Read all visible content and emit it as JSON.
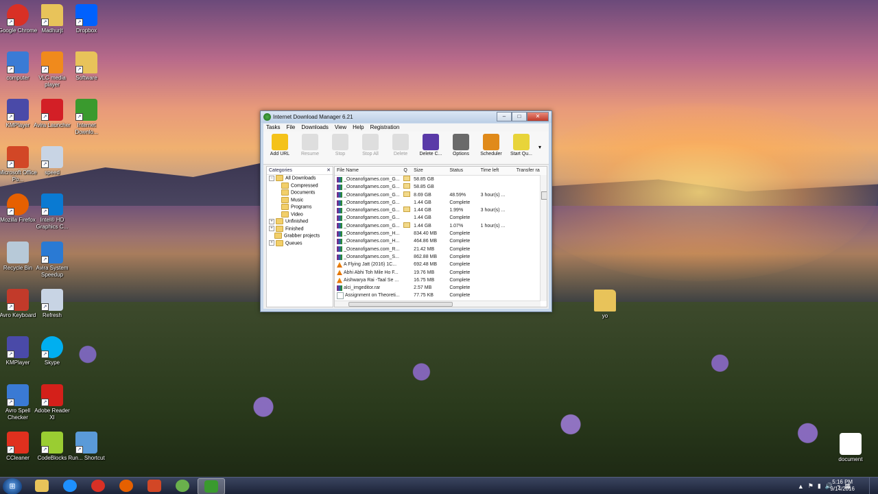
{
  "desktop_icons": [
    {
      "label": "Google Chrome",
      "icon": "chrome-icon",
      "color": "#d93025"
    },
    {
      "label": "Madhurjt",
      "icon": "folder-user-icon",
      "color": "#e8c35a"
    },
    {
      "label": "Dropbox",
      "icon": "dropbox-icon",
      "color": "#0061fe"
    },
    {
      "label": "computer",
      "icon": "computer-icon",
      "color": "#3a7bd5"
    },
    {
      "label": "VLC media player",
      "icon": "vlc-icon",
      "color": "#f08a1c"
    },
    {
      "label": "Software",
      "icon": "folder-icon",
      "color": "#e8c35a"
    },
    {
      "label": "KMPlayer",
      "icon": "kmplayer-icon",
      "color": "#4a4aa8"
    },
    {
      "label": "Avira Launcher",
      "icon": "avira-icon",
      "color": "#d31f26"
    },
    {
      "label": "Internet Downlo...",
      "icon": "idm-icon",
      "color": "#3a9a2e"
    },
    {
      "label": "Microsoft Office Po...",
      "icon": "powerpoint-icon",
      "color": "#d24726"
    },
    {
      "label": "speed",
      "icon": "gear-icon",
      "color": "#c8d4e4"
    },
    {
      "label": "Mozilla Firefox",
      "icon": "firefox-icon",
      "color": "#e66000"
    },
    {
      "label": "Intel® HD Graphics C...",
      "icon": "intel-icon",
      "color": "#0a7ad2"
    },
    {
      "label": "Recycle Bin",
      "icon": "recycle-bin-icon",
      "color": "#b7c9d8"
    },
    {
      "label": "Avira System Speedup",
      "icon": "speedup-icon",
      "color": "#2a7ad4"
    },
    {
      "label": "Avro Keyboard",
      "icon": "avro-icon",
      "color": "#c23a2a"
    },
    {
      "label": "Refresh",
      "icon": "gear-icon",
      "color": "#c8d4e4"
    },
    {
      "label": "KMPlayer",
      "icon": "kmplayer-icon",
      "color": "#4a4aa8"
    },
    {
      "label": "Skype",
      "icon": "skype-icon",
      "color": "#00aff0"
    },
    {
      "label": "Avro Spell Checker",
      "icon": "spellcheck-icon",
      "color": "#3a7ad4"
    },
    {
      "label": "Adobe Reader XI",
      "icon": "adobe-reader-icon",
      "color": "#d4201a"
    },
    {
      "label": "CCleaner",
      "icon": "ccleaner-icon",
      "color": "#e0301e"
    },
    {
      "label": "CodeBlocks",
      "icon": "codeblocks-icon",
      "color": "#9acd32"
    },
    {
      "label": "Run... Shortcut",
      "icon": "run-icon",
      "color": "#5a9ad8"
    },
    {
      "label": "yo",
      "icon": "folder-user-icon",
      "color": "#e8c35a"
    },
    {
      "label": "document",
      "icon": "document-icon",
      "color": "#ffffff"
    }
  ],
  "idm": {
    "title": "Internet Download Manager 6.21",
    "window_buttons": [
      "–",
      "□",
      "✕"
    ],
    "menu": [
      "Tasks",
      "File",
      "Downloads",
      "View",
      "Help",
      "Registration"
    ],
    "toolbar": [
      {
        "label": "Add URL",
        "icon": "add-url-icon",
        "color": "#f4c21a",
        "enabled": true
      },
      {
        "label": "Resume",
        "icon": "resume-icon",
        "color": "#c0c0c0",
        "enabled": false
      },
      {
        "label": "Stop",
        "icon": "stop-icon",
        "color": "#c0c0c0",
        "enabled": false
      },
      {
        "label": "Stop All",
        "icon": "stop-all-icon",
        "color": "#c0c0c0",
        "enabled": false
      },
      {
        "label": "Delete",
        "icon": "delete-icon",
        "color": "#c0c0c0",
        "enabled": false
      },
      {
        "label": "Delete C...",
        "icon": "delete-completed-icon",
        "color": "#5a3aa8",
        "enabled": true
      },
      {
        "label": "Options",
        "icon": "options-icon",
        "color": "#6a6a6a",
        "enabled": true
      },
      {
        "label": "Scheduler",
        "icon": "scheduler-icon",
        "color": "#e08a1a",
        "enabled": true
      },
      {
        "label": "Start Qu...",
        "icon": "start-queue-icon",
        "color": "#e8d43a",
        "enabled": true
      }
    ],
    "toolbar_more": "▾",
    "categories_title": "Categories",
    "categories": [
      {
        "label": "All Downloads",
        "level": 0,
        "expander": "−"
      },
      {
        "label": "Compressed",
        "level": 1
      },
      {
        "label": "Documents",
        "level": 1
      },
      {
        "label": "Music",
        "level": 1
      },
      {
        "label": "Programs",
        "level": 1
      },
      {
        "label": "Video",
        "level": 1
      },
      {
        "label": "Unfinished",
        "level": 0,
        "expander": "+"
      },
      {
        "label": "Finished",
        "level": 0,
        "expander": "+"
      },
      {
        "label": "Grabber projects",
        "level": 0
      },
      {
        "label": "Queues",
        "level": 0,
        "expander": "+"
      }
    ],
    "columns": [
      "File Name",
      "Q",
      "Size",
      "Status",
      "Time left",
      "Transfer ra"
    ],
    "files": [
      {
        "name": "_Oceanofgames.com_G...",
        "type": "rar",
        "q": true,
        "size": "58.85 GB",
        "status": "",
        "time": ""
      },
      {
        "name": "_Oceanofgames.com_G...",
        "type": "rar",
        "q": true,
        "size": "58.85 GB",
        "status": "",
        "time": ""
      },
      {
        "name": "_Oceanofgames.com_G...",
        "type": "rar",
        "q": true,
        "size": "8.69 GB",
        "status": "48.59%",
        "time": "3 hour(s) ..."
      },
      {
        "name": "_Oceanofgames.com_G...",
        "type": "rar",
        "q": false,
        "size": "1.44 GB",
        "status": "Complete",
        "time": ""
      },
      {
        "name": "_Oceanofgames.com_G...",
        "type": "rar",
        "q": true,
        "size": "1.44 GB",
        "status": "1.99%",
        "time": "3 hour(s) ..."
      },
      {
        "name": "_Oceanofgames.com_G...",
        "type": "rar",
        "q": false,
        "size": "1.44 GB",
        "status": "Complete",
        "time": ""
      },
      {
        "name": "_Oceanofgames.com_G...",
        "type": "rar",
        "q": true,
        "size": "1.44 GB",
        "status": "1.07%",
        "time": "1 hour(s) ..."
      },
      {
        "name": "_Oceanofgames.com_H...",
        "type": "rar",
        "q": false,
        "size": "834.40 MB",
        "status": "Complete",
        "time": ""
      },
      {
        "name": "_Oceanofgames.com_H...",
        "type": "rar",
        "q": false,
        "size": "464.86 MB",
        "status": "Complete",
        "time": ""
      },
      {
        "name": "_Oceanofgames.com_R...",
        "type": "rar",
        "q": false,
        "size": "21.42 MB",
        "status": "Complete",
        "time": ""
      },
      {
        "name": "_Oceanofgames.com_S...",
        "type": "rar",
        "q": false,
        "size": "862.88 MB",
        "status": "Complete",
        "time": ""
      },
      {
        "name": "A Flying Jatt (2016) 1C...",
        "type": "vlc",
        "q": false,
        "size": "692.48 MB",
        "status": "Complete",
        "time": ""
      },
      {
        "name": "Abhi Abhi Toh Mile Ho F...",
        "type": "vlc",
        "q": false,
        "size": "19.76 MB",
        "status": "Complete",
        "time": ""
      },
      {
        "name": "Aishwarya Rai -Taal Se ...",
        "type": "vlc",
        "q": false,
        "size": "16.75 MB",
        "status": "Complete",
        "time": ""
      },
      {
        "name": "alci_imgeditor.rar",
        "type": "rar",
        "q": false,
        "size": "2.57 MB",
        "status": "Complete",
        "time": ""
      },
      {
        "name": "Assignment on Theoreti...",
        "type": "doc",
        "q": false,
        "size": "77.75 KB",
        "status": "Complete",
        "time": ""
      }
    ]
  },
  "taskbar": {
    "start_icon": "windows-start-icon",
    "pinned": [
      {
        "icon": "file-explorer-icon",
        "color": "#e8c35a",
        "active": false
      },
      {
        "icon": "internet-explorer-icon",
        "color": "#1e90ff",
        "active": false
      },
      {
        "icon": "chrome-icon",
        "color": "#d93025",
        "active": false
      },
      {
        "icon": "firefox-icon",
        "color": "#e66000",
        "active": false
      },
      {
        "icon": "powerpoint-icon",
        "color": "#d24726",
        "active": false
      },
      {
        "icon": "utorrent-icon",
        "color": "#6ab04c",
        "active": false
      },
      {
        "icon": "idm-icon",
        "color": "#3a9a2e",
        "active": true
      }
    ],
    "tray_icons": [
      "▲",
      "⚑",
      "▮",
      "🔊",
      "⌁",
      "▦"
    ],
    "time": "5:16 PM",
    "date": "9/14/2016"
  }
}
